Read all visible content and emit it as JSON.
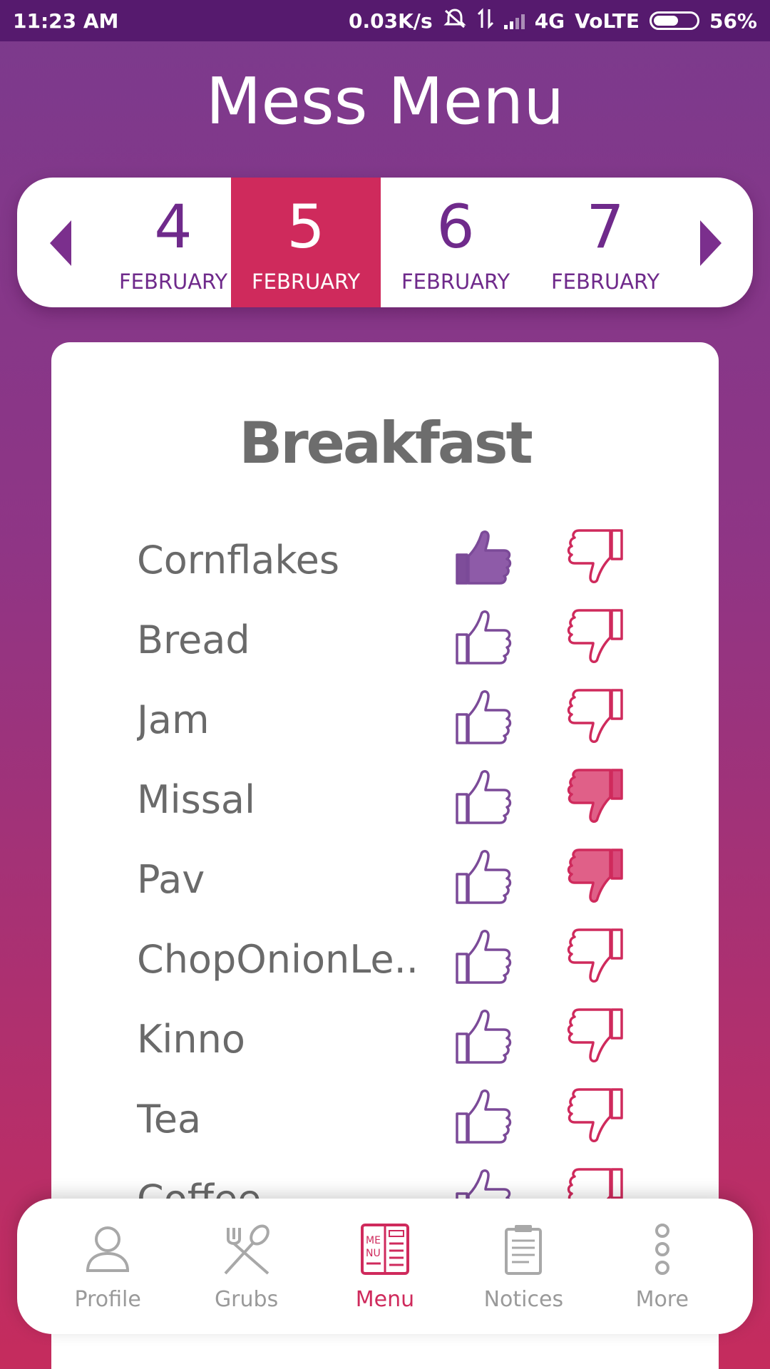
{
  "status_bar": {
    "time": "11:23 AM",
    "speed": "0.03K/s",
    "network": "4G",
    "volte": "VoLTE",
    "battery": "56%",
    "battery_level": 0.56
  },
  "header": {
    "title": "Mess Menu"
  },
  "date_strip": {
    "dates": [
      {
        "day": "4",
        "month": "FEBRUARY",
        "active": false
      },
      {
        "day": "5",
        "month": "FEBRUARY",
        "active": true
      },
      {
        "day": "6",
        "month": "FEBRUARY",
        "active": false
      },
      {
        "day": "7",
        "month": "FEBRUARY",
        "active": false
      }
    ]
  },
  "menu": {
    "meal": "Breakfast",
    "items": [
      {
        "name": "Cornflakes",
        "liked": true,
        "disliked": false
      },
      {
        "name": "Bread",
        "liked": false,
        "disliked": false
      },
      {
        "name": "Jam",
        "liked": false,
        "disliked": false
      },
      {
        "name": "Missal",
        "liked": false,
        "disliked": true
      },
      {
        "name": "Pav",
        "liked": false,
        "disliked": true
      },
      {
        "name": "ChopOnionLe...",
        "liked": false,
        "disliked": false
      },
      {
        "name": "Kinno",
        "liked": false,
        "disliked": false
      },
      {
        "name": "Tea",
        "liked": false,
        "disliked": false
      },
      {
        "name": "Coffee",
        "liked": false,
        "disliked": false
      }
    ]
  },
  "bottom_nav": {
    "items": [
      {
        "label": "Profile",
        "icon": "person-icon",
        "active": false
      },
      {
        "label": "Grubs",
        "icon": "fork-spoon-icon",
        "active": false
      },
      {
        "label": "Menu",
        "icon": "menu-book-icon",
        "active": true
      },
      {
        "label": "Notices",
        "icon": "clipboard-icon",
        "active": false
      },
      {
        "label": "More",
        "icon": "more-dots-icon",
        "active": false
      }
    ]
  },
  "colors": {
    "primary_purple": "#7b2f8d",
    "accent_pink": "#cf2a5c",
    "status_bar": "#561a6e"
  }
}
